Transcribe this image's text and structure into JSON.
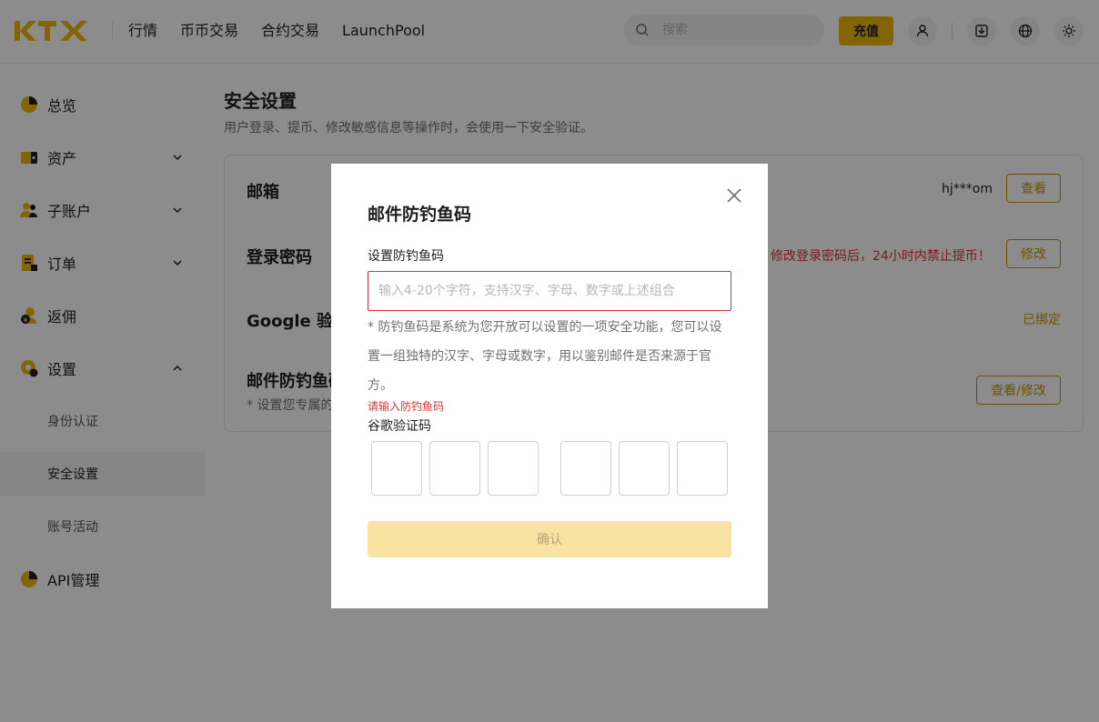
{
  "header": {
    "nav": [
      "行情",
      "币币交易",
      "合约交易",
      "LaunchPool"
    ],
    "search_placeholder": "搜索",
    "recharge_label": "充值",
    "brand_color": "#f0b90b"
  },
  "sidebar": {
    "items": [
      {
        "label": "总览",
        "icon": "overview-icon"
      },
      {
        "label": "资产",
        "icon": "wallet-icon"
      },
      {
        "label": "子账户",
        "icon": "subaccount-icon"
      },
      {
        "label": "订单",
        "icon": "order-icon"
      },
      {
        "label": "返佣",
        "icon": "commission-icon"
      },
      {
        "label": "设置",
        "icon": "settings-icon"
      },
      {
        "label": "API管理",
        "icon": "api-icon"
      }
    ],
    "sub_items": [
      "身份认证",
      "安全设置",
      "账号活动"
    ],
    "active_sub": "安全设置"
  },
  "main": {
    "title": "安全设置",
    "subtitle": "用户登录、提币、修改敏感信息等操作时，会使用一下安全验证。",
    "rows": {
      "email_label": "邮箱",
      "email_value": "hj***om",
      "email_btn": "查看",
      "password_label": "登录密码",
      "password_warning": "修改登录密码后，24小时内禁止提币！",
      "password_btn": "修改",
      "google_label": "Google 验证",
      "google_status": "已绑定",
      "antiphish_label": "邮件防钓鱼码",
      "antiphish_note": "* 设置您专属的",
      "antiphish_btn": "查看/修改"
    }
  },
  "modal": {
    "title": "邮件防钓鱼码",
    "code_label": "设置防钓鱼码",
    "code_placeholder": "输入4-20个字符，支持汉字、字母、数字或上述组合",
    "hint": "* 防钓鱼码是系统为您开放可以设置的一项安全功能，您可以设置一组独特的汉字、字母或数字，用以鉴别邮件是否来源于官方。",
    "error": "请输入防钓鱼码",
    "google_label": "谷歌验证码",
    "confirm_label": "确认",
    "error_color": "#e03131"
  }
}
